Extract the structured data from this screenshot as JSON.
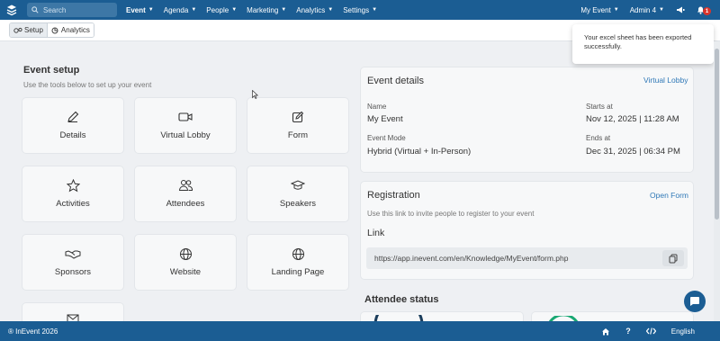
{
  "header": {
    "search_placeholder": "Search",
    "nav": [
      {
        "label": "Event",
        "active": true
      },
      {
        "label": "Agenda"
      },
      {
        "label": "People"
      },
      {
        "label": "Marketing"
      },
      {
        "label": "Analytics"
      },
      {
        "label": "Settings"
      }
    ],
    "event_selector": "My Event",
    "admin_menu": "Admin 4",
    "notification_count": "1"
  },
  "subbar": {
    "tabs": [
      {
        "label": "Setup",
        "icon": "gears-icon",
        "active": true
      },
      {
        "label": "Analytics",
        "icon": "chart-icon"
      }
    ]
  },
  "setup": {
    "title": "Event setup",
    "subtitle": "Use the tools below to set up your event",
    "tiles": [
      {
        "label": "Details",
        "icon": "pencil-icon"
      },
      {
        "label": "Virtual Lobby",
        "icon": "video-icon"
      },
      {
        "label": "Form",
        "icon": "edit-square-icon"
      },
      {
        "label": "Activities",
        "icon": "star-icon"
      },
      {
        "label": "Attendees",
        "icon": "users-icon"
      },
      {
        "label": "Speakers",
        "icon": "graduation-cap-icon"
      },
      {
        "label": "Sponsors",
        "icon": "handshake-icon"
      },
      {
        "label": "Website",
        "icon": "globe-icon"
      },
      {
        "label": "Landing Page",
        "icon": "globe-icon"
      }
    ]
  },
  "event_details": {
    "title": "Event details",
    "action_link": "Virtual Lobby",
    "name_label": "Name",
    "name_value": "My Event",
    "starts_label": "Starts at",
    "starts_value": "Nov 12, 2025 | 11:28 AM",
    "mode_label": "Event Mode",
    "mode_value": "Hybrid (Virtual + In-Person)",
    "ends_label": "Ends at",
    "ends_value": "Dec 31, 2025 | 06:34 PM"
  },
  "registration": {
    "title": "Registration",
    "action_link": "Open Form",
    "description": "Use this link to invite people to register to your event",
    "link_label": "Link",
    "link_url": "https://app.inevent.com/en/Knowledge/MyEvent/form.php"
  },
  "attendee_status": {
    "title": "Attendee status"
  },
  "toast": {
    "message": "Your excel sheet has been exported successfully."
  },
  "footer": {
    "copyright": "® InEvent 2026",
    "language": "English"
  },
  "colors": {
    "primary": "#1b5d93",
    "accent_link": "#2f78b7",
    "badge": "#d9342b",
    "background": "#eef0f3"
  }
}
